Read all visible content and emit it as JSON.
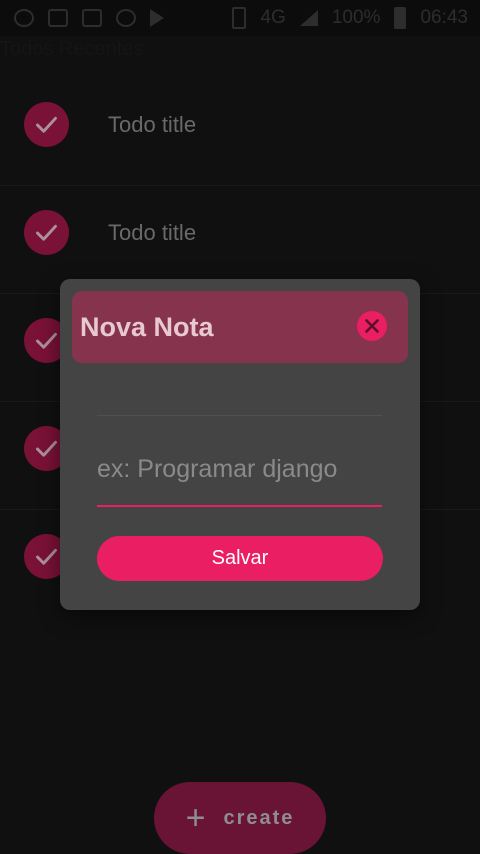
{
  "status_bar": {
    "network": "4G",
    "battery": "100%",
    "time": "06:43",
    "icons": [
      "whatsapp-icon",
      "gmail-icon",
      "gallery-icon",
      "settings-icon",
      "play-store-icon",
      "phone-icon",
      "signal-icon",
      "battery-icon"
    ]
  },
  "app": {
    "title": "Todos Recentes"
  },
  "todos": [
    {
      "title": "Todo title"
    },
    {
      "title": "Todo title"
    },
    {
      "title": ""
    },
    {
      "title": ""
    },
    {
      "title": ""
    }
  ],
  "fab": {
    "plus": "+",
    "label": "create"
  },
  "dialog": {
    "title": "Nova Nota",
    "input_placeholder": "ex: Programar django",
    "input_value": "",
    "save_label": "Salvar"
  },
  "colors": {
    "accent": "#e91e63",
    "check_circle": "#a3174a",
    "dialog_header": "#86334d",
    "dialog_bg": "#444444",
    "background": "#161616"
  }
}
